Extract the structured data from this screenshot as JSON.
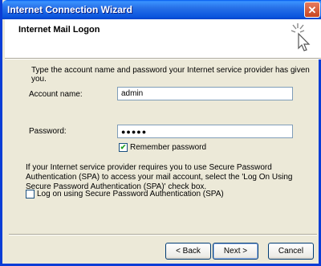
{
  "window": {
    "title": "Internet Connection Wizard",
    "close_glyph": "✕"
  },
  "header": {
    "title": "Internet Mail Logon",
    "icon": "wizard-wand-icon"
  },
  "intro_text": "Type the account name and password your Internet service provider has given you.",
  "account": {
    "label": "Account name:",
    "value": "admin"
  },
  "password": {
    "label": "Password:",
    "value": "●●●●●"
  },
  "remember": {
    "label": "Remember password",
    "checked": true,
    "mark": "✔"
  },
  "spa": {
    "description": "If your Internet service provider requires you to use Secure Password Authentication (SPA) to access your mail account, select the 'Log On Using Secure Password Authentication (SPA)' check box.",
    "checkbox_label": "Log on using Secure Password Authentication (SPA)",
    "checked": false
  },
  "buttons": {
    "back": "< Back",
    "next": "Next >",
    "cancel": "Cancel"
  },
  "colors": {
    "titlebar": "#0A55DE",
    "dialog_bg": "#ECE9D8",
    "textbox_border": "#7F9DB9"
  }
}
